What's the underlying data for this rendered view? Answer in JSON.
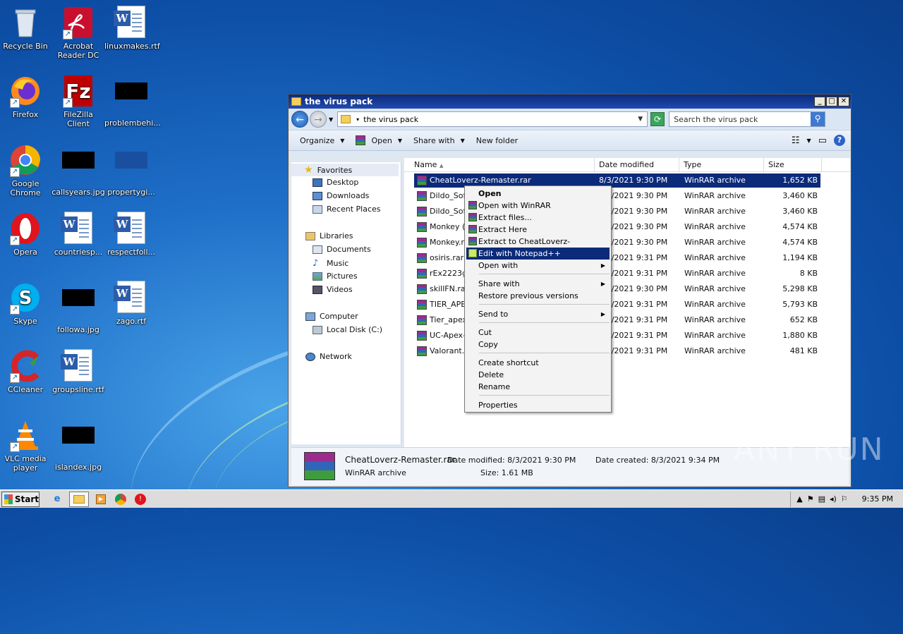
{
  "desktop": {
    "icons": [
      {
        "label": "Recycle Bin"
      },
      {
        "label": "Acrobat Reader DC"
      },
      {
        "label": "linuxmakes.rtf"
      },
      {
        "label": "Firefox"
      },
      {
        "label": "FileZilla Client"
      },
      {
        "label": "problembehi..."
      },
      {
        "label": "Google Chrome"
      },
      {
        "label": "callsyears.jpg"
      },
      {
        "label": "propertygi..."
      },
      {
        "label": "Opera"
      },
      {
        "label": "countriesp..."
      },
      {
        "label": "respectfoll..."
      },
      {
        "label": "Skype"
      },
      {
        "label": "followa.jpg"
      },
      {
        "label": "zago.rtf"
      },
      {
        "label": "CCleaner"
      },
      {
        "label": "groupsline.rtf"
      },
      {
        "label": "VLC media player"
      },
      {
        "label": "islandex.jpg"
      }
    ]
  },
  "window": {
    "title": "the virus pack",
    "address": "the virus pack",
    "search_placeholder": "Search the virus pack",
    "toolbar": {
      "organize": "Organize",
      "open": "Open",
      "share_with": "Share with",
      "new_folder": "New folder"
    },
    "nav": {
      "favorites": "Favorites",
      "desktop": "Desktop",
      "downloads": "Downloads",
      "recent_places": "Recent Places",
      "libraries": "Libraries",
      "documents": "Documents",
      "music": "Music",
      "pictures": "Pictures",
      "videos": "Videos",
      "computer": "Computer",
      "local_disk": "Local Disk (C:)",
      "network": "Network"
    },
    "columns": {
      "name": "Name",
      "date_modified": "Date modified",
      "type": "Type",
      "size": "Size"
    },
    "files": [
      {
        "name": "CheatLoverz-Remaster.rar",
        "date": "8/3/2021 9:30 PM",
        "type": "WinRAR archive",
        "size": "1,652 KB"
      },
      {
        "name": "Dildo_Soft",
        "date": "8/3/2021 9:30 PM",
        "type": "WinRAR archive",
        "size": "3,460 KB"
      },
      {
        "name": "Dildo_Soft",
        "date": "8/3/2021 9:30 PM",
        "type": "WinRAR archive",
        "size": "3,460 KB"
      },
      {
        "name": "Monkey (1",
        "date": "8/3/2021 9:30 PM",
        "type": "WinRAR archive",
        "size": "4,574 KB"
      },
      {
        "name": "Monkey.ra",
        "date": "8/3/2021 9:30 PM",
        "type": "WinRAR archive",
        "size": "4,574 KB"
      },
      {
        "name": "osiris.rar",
        "date": "8/3/2021 9:31 PM",
        "type": "WinRAR archive",
        "size": "1,194 KB"
      },
      {
        "name": "rEx2223gx",
        "date": "8/3/2021 9:31 PM",
        "type": "WinRAR archive",
        "size": "8 KB"
      },
      {
        "name": "skillFN.rar",
        "date": "8/3/2021 9:30 PM",
        "type": "WinRAR archive",
        "size": "5,298 KB"
      },
      {
        "name": "TIER_APEX",
        "date": "8/3/2021 9:31 PM",
        "type": "WinRAR archive",
        "size": "5,793 KB"
      },
      {
        "name": "Tier_apex",
        "date": "8/3/2021 9:31 PM",
        "type": "WinRAR archive",
        "size": "652 KB"
      },
      {
        "name": "UC-Apex-F",
        "date": "8/3/2021 9:31 PM",
        "type": "WinRAR archive",
        "size": "1,880 KB"
      },
      {
        "name": "Valorant.ra",
        "date": "8/3/2021 9:31 PM",
        "type": "WinRAR archive",
        "size": "481 KB"
      }
    ],
    "details": {
      "filename": "CheatLoverz-Remaster.rar",
      "filetype": "WinRAR archive",
      "date_modified": "Date modified: 8/3/2021 9:30 PM",
      "size": "Size: 1.61 MB",
      "date_created": "Date created: 8/3/2021 9:34 PM"
    }
  },
  "context_menu": {
    "open": "Open",
    "open_winrar": "Open with WinRAR",
    "extract_files": "Extract files...",
    "extract_here": "Extract Here",
    "extract_to": "Extract to CheatLoverz-Remaster\\",
    "edit_npp": "Edit with Notepad++",
    "open_with": "Open with",
    "share_with": "Share with",
    "restore": "Restore previous versions",
    "send_to": "Send to",
    "cut": "Cut",
    "copy": "Copy",
    "create_shortcut": "Create shortcut",
    "delete": "Delete",
    "rename": "Rename",
    "properties": "Properties"
  },
  "taskbar": {
    "start": "Start",
    "clock": "9:35 PM"
  },
  "watermark": "ANY RUN"
}
